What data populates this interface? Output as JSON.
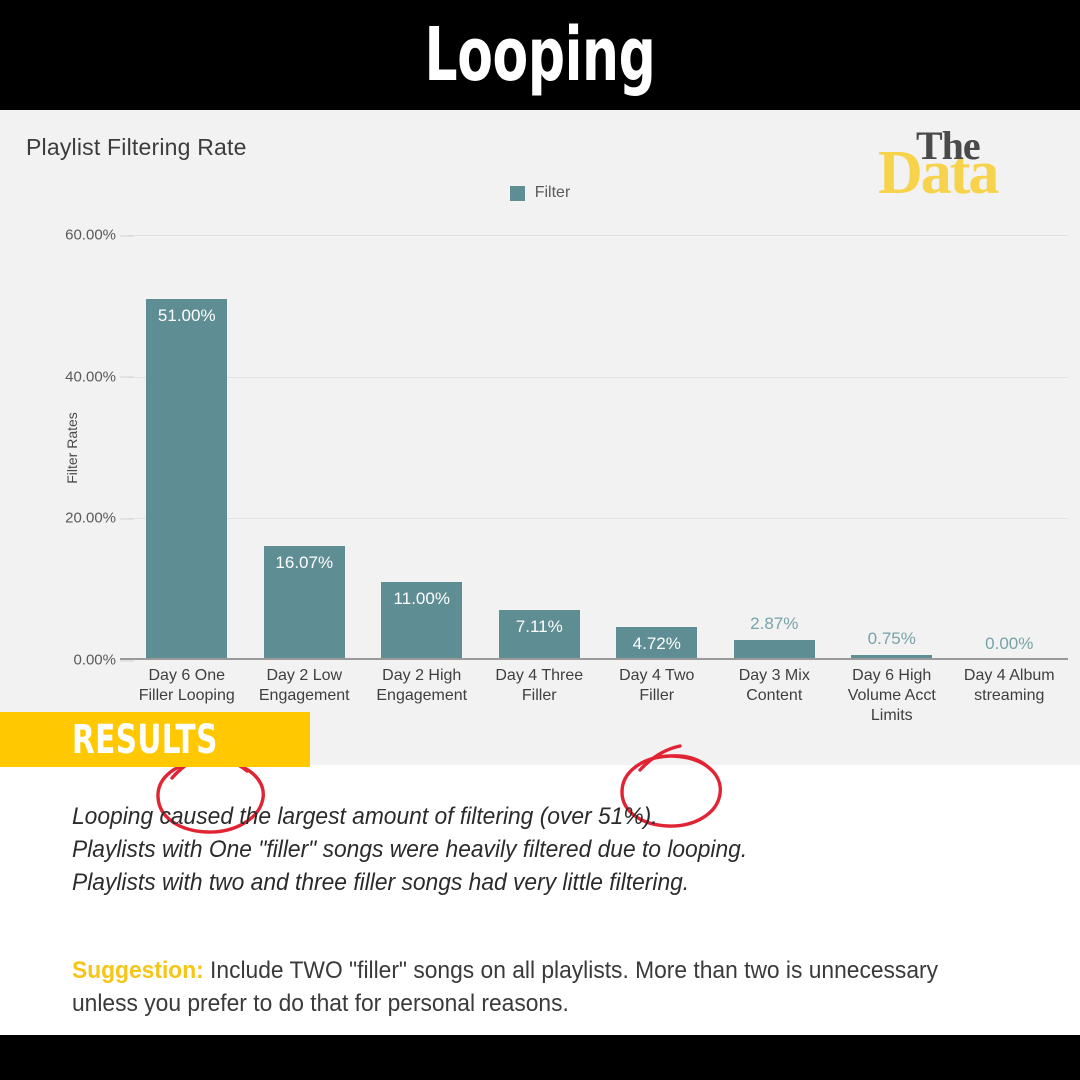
{
  "header": {
    "title": "Looping"
  },
  "brand": {
    "word_top": "The",
    "word_bottom": "Data",
    "accent_color": "#f7d24b"
  },
  "chart_panel": {
    "title": "Playlist Filtering Rate",
    "legend_label": "Filter",
    "series_color": "#5f8d94"
  },
  "results": {
    "banner_label": "RESULTS",
    "banner_color": "#ffc800",
    "findings": [
      "Looping caused the largest amount of filtering (over 51%).",
      "Playlists with One \"filler\" songs were heavily filtered due to looping.",
      "Playlists with two and three filler songs had very little filtering."
    ],
    "suggestion_label": "Suggestion:",
    "suggestion_text": " Include TWO \"filler\" songs on all playlists. More than two is unnecessary unless you prefer to do that for personal reasons."
  },
  "annotations": [
    {
      "name": "circle-day-6-one-filler-looping",
      "target": "Day 6 One Filler Looping",
      "color": "#e02434"
    },
    {
      "name": "circle-day-4-two-filler",
      "target": "Day 4 Two Filler",
      "color": "#e02434"
    }
  ],
  "chart_data": {
    "type": "bar",
    "title": "Playlist Filtering Rate",
    "xlabel": "",
    "ylabel": "Filter Rates",
    "legend": [
      "Filter"
    ],
    "legend_position": "top-center",
    "grid": true,
    "ylim": [
      0,
      60
    ],
    "yticks": [
      0,
      20,
      40,
      60
    ],
    "ytick_labels": [
      "0.00%",
      "20.00%",
      "40.00%",
      "60.00%"
    ],
    "categories": [
      "Day 6 One Filler Looping",
      "Day 2 Low Engagement",
      "Day 2 High Engagement",
      "Day 4 Three Filler",
      "Day 4 Two Filler",
      "Day 3 Mix Content",
      "Day 6 High Volume Acct Limits",
      "Day 4 Album streaming"
    ],
    "values": [
      51.0,
      16.07,
      11.0,
      7.11,
      4.72,
      2.87,
      0.75,
      0.0
    ],
    "value_labels": [
      "51.00%",
      "16.07%",
      "11.00%",
      "7.11%",
      "4.72%",
      "2.87%",
      "0.75%",
      "0.00%"
    ],
    "label_inside": [
      true,
      true,
      true,
      true,
      true,
      false,
      false,
      false
    ],
    "series": [
      {
        "name": "Filter",
        "color": "#5f8d94",
        "values": [
          51.0,
          16.07,
          11.0,
          7.11,
          4.72,
          2.87,
          0.75,
          0.0
        ]
      }
    ]
  }
}
